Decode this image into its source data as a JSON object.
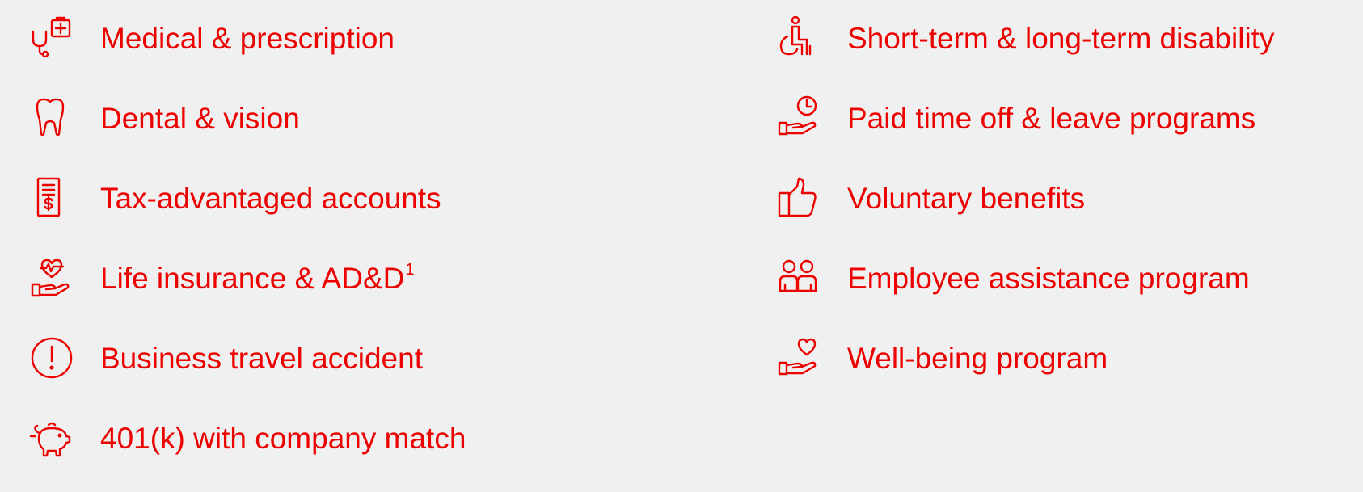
{
  "theme": {
    "accent": "#ec0000",
    "background": "#f0f0f0"
  },
  "benefits": {
    "left": [
      {
        "icon": "stethoscope-medical-kit-icon",
        "label": "Medical & prescription"
      },
      {
        "icon": "tooth-icon",
        "label": "Dental & vision"
      },
      {
        "icon": "dollar-document-icon",
        "label": "Tax-advantaged accounts"
      },
      {
        "icon": "heartbeat-hand-icon",
        "label": "Life insurance & AD&D",
        "footnote": "1"
      },
      {
        "icon": "exclamation-circle-icon",
        "label": "Business travel accident"
      },
      {
        "icon": "piggy-bank-icon",
        "label": "401(k) with company match"
      }
    ],
    "right": [
      {
        "icon": "wheelchair-icon",
        "label": "Short-term & long-term disability"
      },
      {
        "icon": "clock-hand-icon",
        "label": "Paid time off & leave programs"
      },
      {
        "icon": "thumbs-up-icon",
        "label": "Voluntary benefits"
      },
      {
        "icon": "two-people-icon",
        "label": "Employee assistance program"
      },
      {
        "icon": "heart-hand-icon",
        "label": "Well-being program"
      }
    ]
  }
}
